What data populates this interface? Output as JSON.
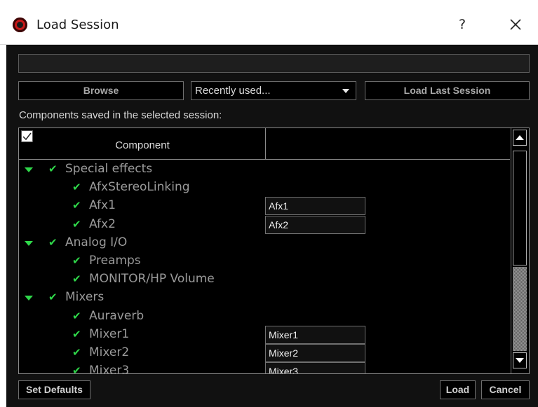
{
  "window": {
    "title": "Load Session",
    "help_label": "?"
  },
  "toolbar": {
    "path_value": "",
    "browse_label": "Browse",
    "dropdown_value": "Recently used...",
    "load_last_label": "Load Last Session"
  },
  "components_label": "Components saved in the selected session:",
  "table": {
    "header_component": "Component",
    "header_name": "",
    "header_checked": true,
    "rows": [
      {
        "label": "Special effects",
        "level": 0,
        "checked": true,
        "expanded": true,
        "name": ""
      },
      {
        "label": "AfxStereoLinking",
        "level": 1,
        "checked": true,
        "name": ""
      },
      {
        "label": "Afx1",
        "level": 1,
        "checked": true,
        "name": "Afx1"
      },
      {
        "label": "Afx2",
        "level": 1,
        "checked": true,
        "name": "Afx2"
      },
      {
        "label": "Analog I/O",
        "level": 0,
        "checked": true,
        "expanded": true,
        "name": ""
      },
      {
        "label": "Preamps",
        "level": 1,
        "checked": true,
        "name": ""
      },
      {
        "label": "MONITOR/HP Volume",
        "level": 1,
        "checked": true,
        "name": ""
      },
      {
        "label": "Mixers",
        "level": 0,
        "checked": true,
        "expanded": true,
        "name": ""
      },
      {
        "label": "Auraverb",
        "level": 1,
        "checked": true,
        "name": ""
      },
      {
        "label": "Mixer1",
        "level": 1,
        "checked": true,
        "name": "Mixer1"
      },
      {
        "label": "Mixer2",
        "level": 1,
        "checked": true,
        "name": "Mixer2"
      },
      {
        "label": "Mixer3",
        "level": 1,
        "checked": true,
        "name": "Mixer3"
      }
    ]
  },
  "footer": {
    "set_defaults_label": "Set Defaults",
    "load_label": "Load",
    "cancel_label": "Cancel"
  },
  "colors": {
    "accent_green": "#2fd84a",
    "background": "#111111",
    "app_icon_red": "#c81818"
  },
  "icons": {
    "app": "app-logo-icon",
    "help": "help-icon",
    "close": "close-icon",
    "dropdown": "dropdown-arrow-icon",
    "expand": "triangle-down-icon",
    "check": "checkmark-icon",
    "scroll_up": "scroll-up-arrow-icon",
    "scroll_down": "scroll-down-arrow-icon"
  }
}
